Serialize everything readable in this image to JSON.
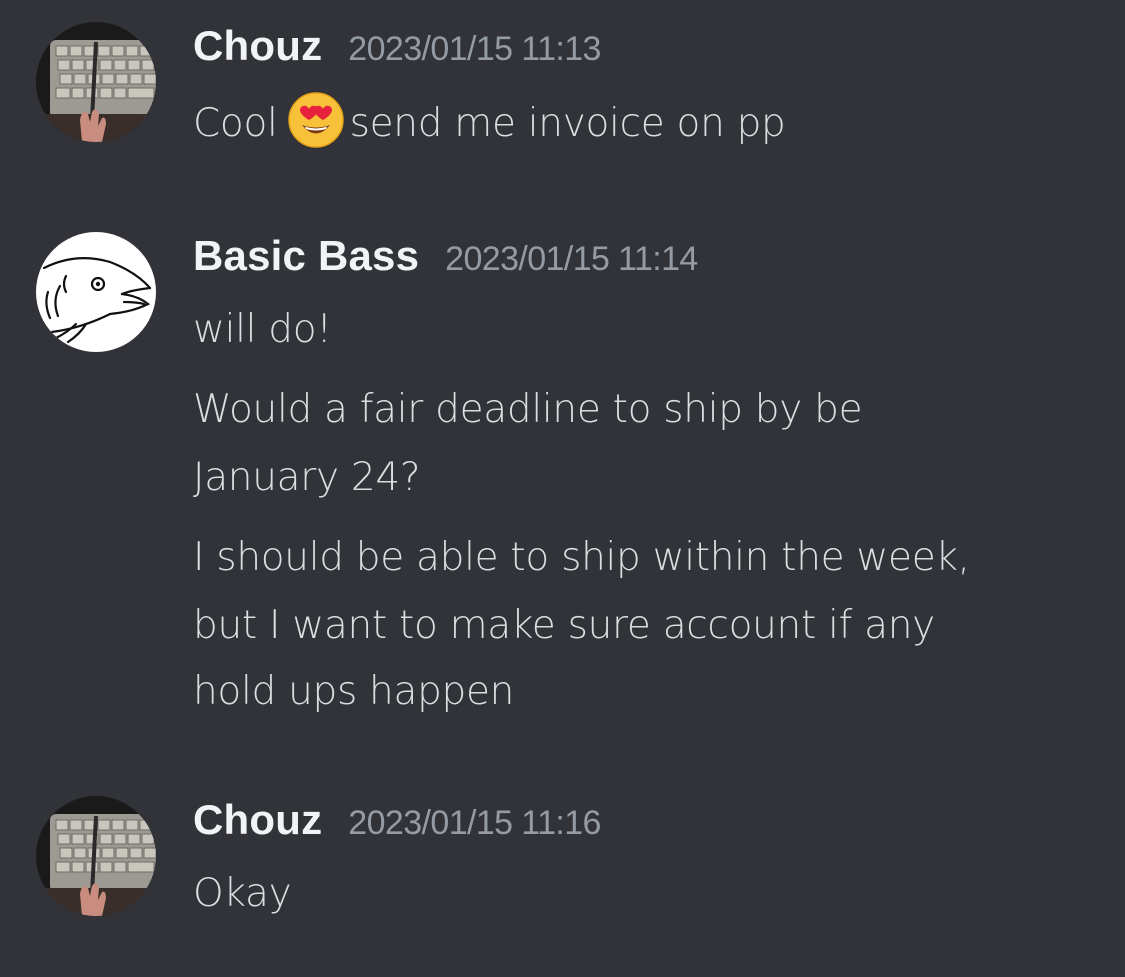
{
  "messages": [
    {
      "author": "Chouz",
      "timestamp": "2023/01/15 11:13",
      "avatar": "keyboard-avatar",
      "lines": [
        {
          "before_emoji": "Cool",
          "emoji": "smiling-face-with-heart-eyes",
          "after_emoji": "send me invoice on pp"
        }
      ]
    },
    {
      "author": "Basic Bass",
      "timestamp": "2023/01/15 11:14",
      "avatar": "fish-drawing-avatar",
      "lines": [
        "will do!",
        "Would a fair deadline to ship by be",
        "January 24?",
        "I should be able to ship within the week,",
        "but I want to make sure  account if any",
        "hold ups happen"
      ]
    },
    {
      "author": "Chouz",
      "timestamp": "2023/01/15 11:16",
      "avatar": "keyboard-avatar",
      "lines": [
        "Okay"
      ]
    }
  ],
  "colors": {
    "background": "#313338",
    "username": "#f2f3f5",
    "timestamp": "#949ba4",
    "message_text": "#dbdee1"
  }
}
